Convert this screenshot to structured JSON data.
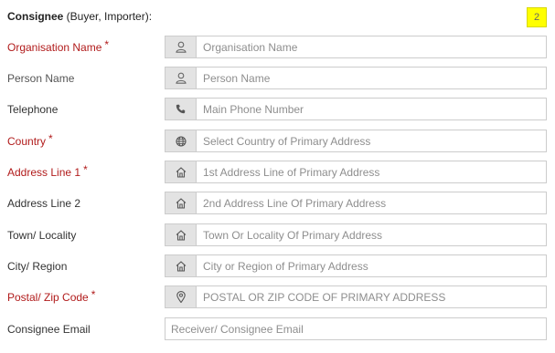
{
  "section": {
    "title_strong": "Consignee",
    "title_rest": " (Buyer, Importer):",
    "badge": "2"
  },
  "fields": [
    {
      "label": "Organisation Name",
      "required": true,
      "icon": "user-icon",
      "placeholder": "Organisation Name",
      "value": ""
    },
    {
      "label": "Person Name",
      "required": false,
      "icon": "user-icon",
      "placeholder": "Person Name",
      "value": ""
    },
    {
      "label": "Telephone",
      "required": false,
      "icon": "phone-icon",
      "placeholder": "Main Phone Number",
      "value": ""
    },
    {
      "label": "Country",
      "required": true,
      "icon": "globe-icon",
      "placeholder": "Select Country of Primary Address",
      "value": ""
    },
    {
      "label": "Address Line 1",
      "required": true,
      "icon": "home-icon",
      "placeholder": "1st Address Line of Primary Address",
      "value": ""
    },
    {
      "label": "Address Line 2",
      "required": false,
      "icon": "home-icon",
      "placeholder": "2nd Address Line Of Primary Address",
      "value": ""
    },
    {
      "label": "Town/ Locality",
      "required": false,
      "icon": "home-icon",
      "placeholder": "Town Or Locality Of Primary Address",
      "value": ""
    },
    {
      "label": "City/ Region",
      "required": false,
      "icon": "home-icon",
      "placeholder": "City or Region of Primary Address",
      "value": ""
    },
    {
      "label": "Postal/ Zip Code",
      "required": true,
      "icon": "map-marker-icon",
      "placeholder": "POSTAL OR ZIP CODE OF PRIMARY ADDRESS",
      "value": ""
    },
    {
      "label": "Consignee Email",
      "required": false,
      "icon": "",
      "placeholder": "Receiver/ Consignee Email",
      "value": ""
    }
  ],
  "colors": {
    "required_label": "#b11b1b",
    "badge_bg": "#ffff00",
    "addon_bg": "#e3e3e3",
    "border": "#cccccc"
  },
  "required_marker": "*"
}
